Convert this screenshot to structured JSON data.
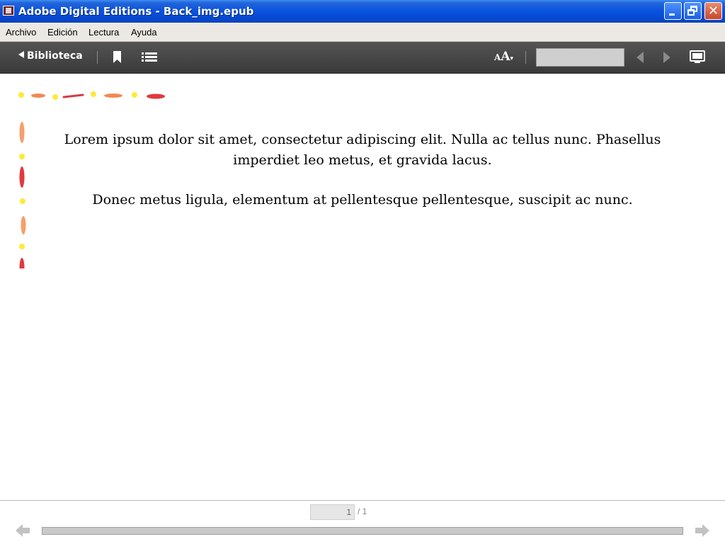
{
  "window": {
    "title": "Adobe Digital Editions - Back_img.epub",
    "close_glyph": "✕"
  },
  "menu": {
    "items": [
      "Archivo",
      "Edición",
      "Lectura",
      "Ayuda"
    ]
  },
  "toolbar": {
    "library_label": "Biblioteca",
    "font_size_label_small": "A",
    "font_size_label_large": "A",
    "icons": [
      "back-triangle-icon",
      "bookmark-icon",
      "toc-list-icon",
      "font-size-icon",
      "prev-page-icon",
      "next-page-icon",
      "fullscreen-icon"
    ],
    "search_value": ""
  },
  "content": {
    "paragraphs": [
      "Lorem ipsum dolor sit amet, consectetur adipiscing elit. Nulla ac tellus nunc. Phasellus imperdiet leo metus, et gravida lacus.",
      "Donec metus ligula, elementum at pellentesque pellentesque, suscipit ac nunc."
    ],
    "border_colors": [
      "#ffe93a",
      "#f08a55",
      "#e0393f",
      "#f5a06a"
    ]
  },
  "pagination": {
    "current_page": "1",
    "total_label": "/ 1",
    "progress": 0
  }
}
